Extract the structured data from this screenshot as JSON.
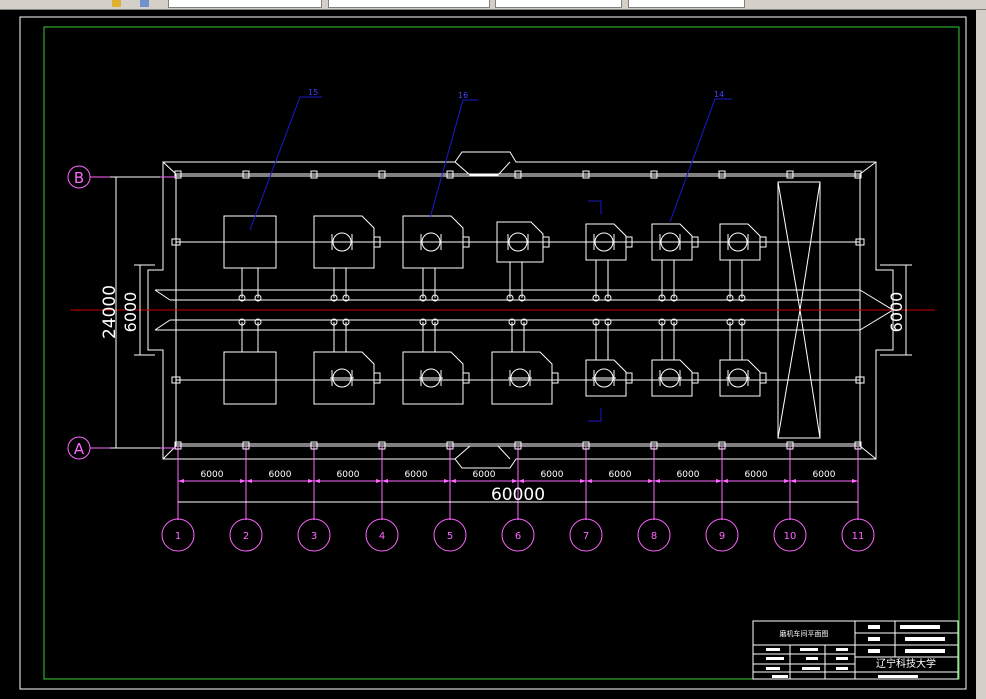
{
  "toolbar": {
    "fields": [
      {
        "name": "layer-combo",
        "value": ""
      },
      {
        "name": "linetype-combo",
        "value": ""
      },
      {
        "name": "lineweight-combo",
        "value": ""
      },
      {
        "name": "plotstyle-combo",
        "value": ""
      }
    ]
  },
  "drawing": {
    "axis_rows": [
      "B",
      "A"
    ],
    "axis_columns": [
      "1",
      "2",
      "3",
      "4",
      "5",
      "6",
      "7",
      "8",
      "9",
      "10",
      "11"
    ],
    "bay_dimensions": [
      "6000",
      "6000",
      "6000",
      "6000",
      "6000",
      "6000",
      "6000",
      "6000",
      "6000",
      "6000"
    ],
    "total_length": "60000",
    "total_width": "24000",
    "span_left": "6000",
    "span_right": "6000",
    "callouts": [
      "15",
      "16",
      "14"
    ]
  },
  "title_block": {
    "drawing_title": "磨机车间平面图",
    "school": "辽宁科技大学"
  },
  "colors": {
    "outline": "#ffffff",
    "axis": "#ff66ff",
    "leader": "#1a1acc",
    "centerline": "#cc0000",
    "frame": "#33cc33"
  }
}
